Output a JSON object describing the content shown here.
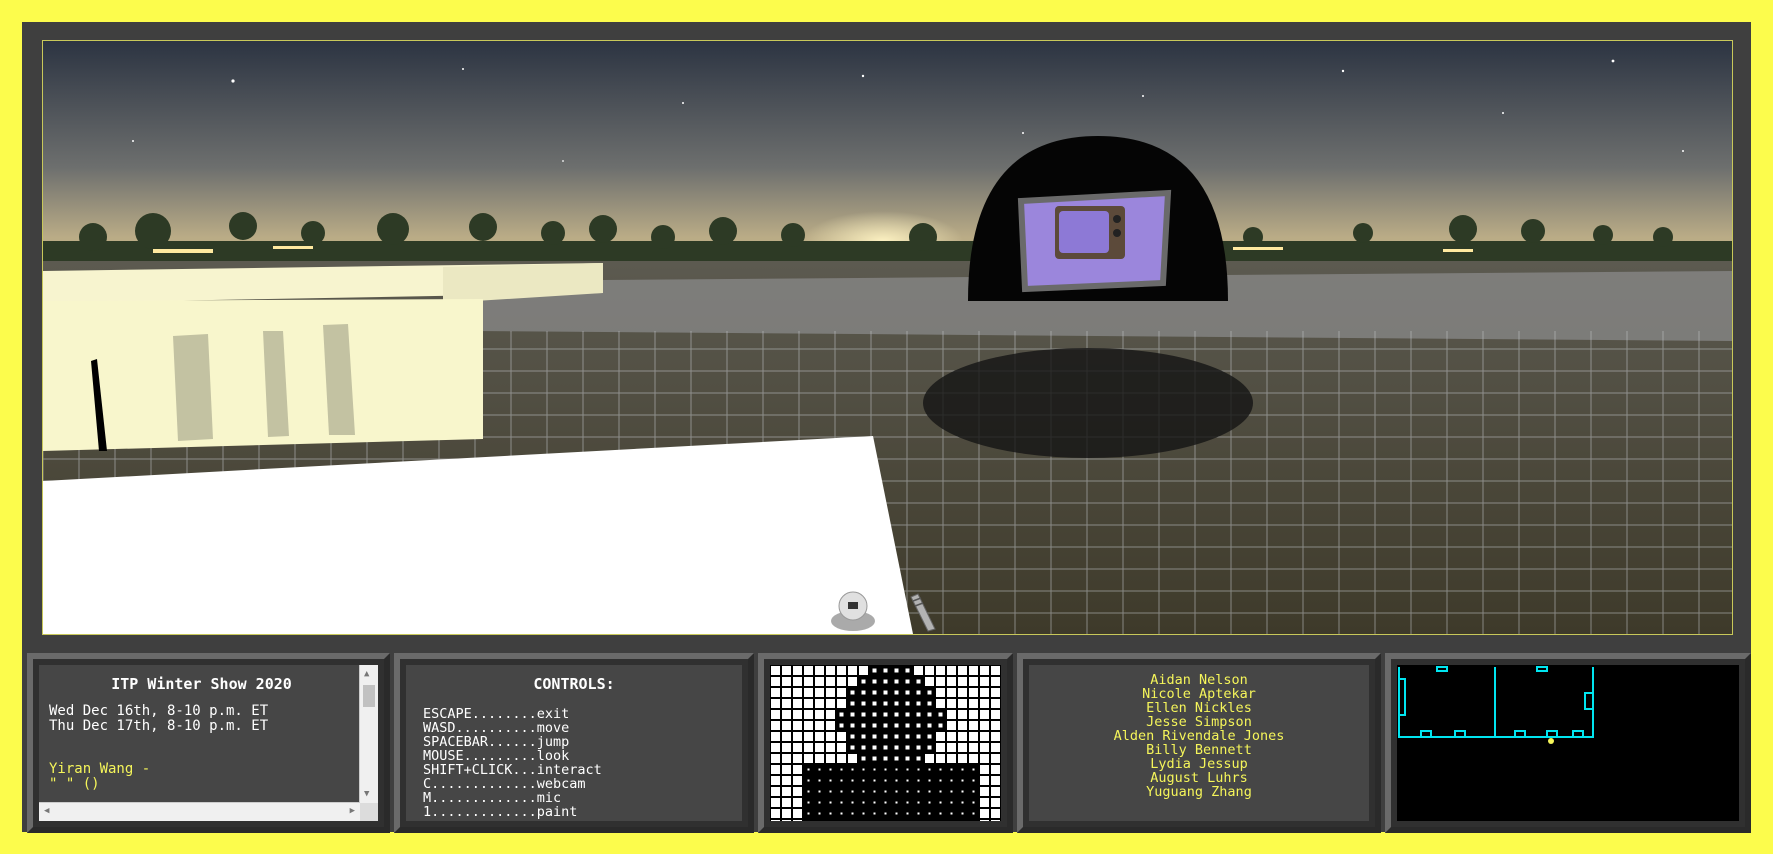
{
  "info_panel": {
    "title": "ITP Winter Show 2020",
    "dates": [
      "Wed Dec 16th, 8-10 p.m. ET",
      "Thu Dec 17th, 8-10 p.m. ET"
    ],
    "artist_line": "Yiran Wang -",
    "project_line": "\" \" ()"
  },
  "controls_panel": {
    "title": "CONTROLS:",
    "items": [
      "ESCAPE........exit",
      "WASD..........move",
      "SPACEBAR......jump",
      "MOUSE.........look",
      "SHIFT+CLICK...interact",
      "C.............webcam",
      "M.............mic",
      "1.............paint"
    ]
  },
  "names_panel": {
    "names": [
      "Aidan Nelson",
      "Nicole Aptekar",
      "Ellen Nickles",
      "Jesse Simpson",
      "Alden Rivendale Jones",
      "Billy Bennett",
      "Lydia Jessup",
      "August Luhrs",
      "Yuguang Zhang"
    ]
  },
  "colors": {
    "background": "#fcfc4c",
    "frame": "#3f3f3f",
    "panel": "#464646",
    "highlight_text": "#f5f55a",
    "map_walls": "#00e5f0",
    "screen_purple": "#9b86dc"
  },
  "icons": {
    "webcam": "webcam-icon",
    "mic": "microphone-icon",
    "scroll_up": "arrow-up-icon",
    "scroll_down": "arrow-down-icon",
    "scroll_left": "arrow-left-icon",
    "scroll_right": "arrow-right-icon"
  }
}
